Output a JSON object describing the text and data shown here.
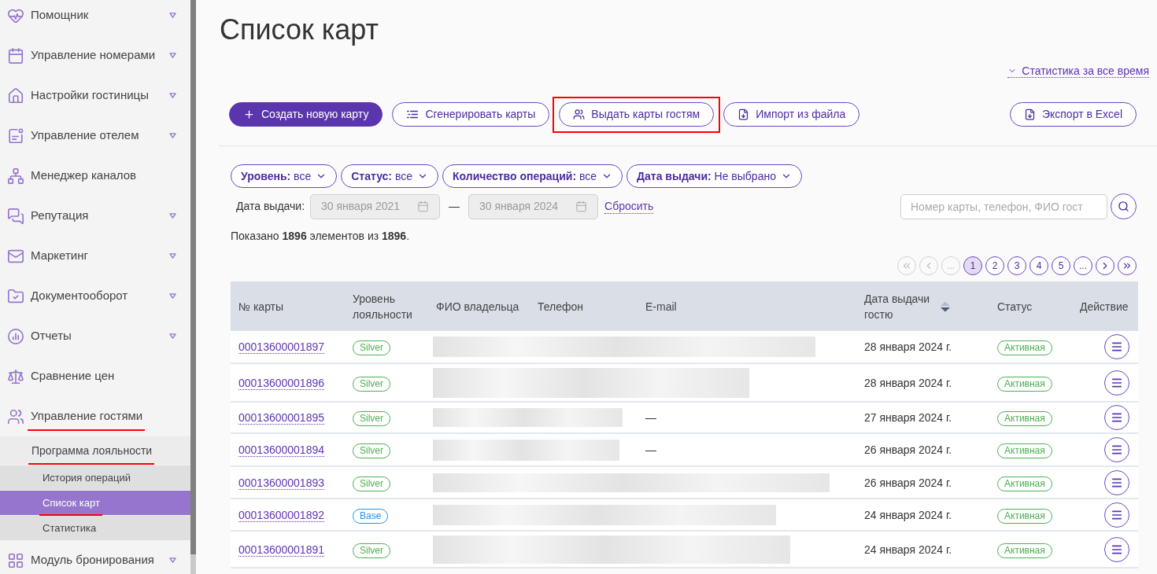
{
  "sidebar": {
    "items": [
      {
        "label": "Помощник",
        "expandable": true,
        "selected": false,
        "annotated": false
      },
      {
        "label": "Управление номерами",
        "expandable": true,
        "selected": false,
        "annotated": false
      },
      {
        "label": "Настройки гостиницы",
        "expandable": true,
        "selected": false,
        "annotated": false
      },
      {
        "label": "Управление отелем",
        "expandable": true,
        "selected": false,
        "annotated": false
      },
      {
        "label": "Менеджер каналов",
        "expandable": false,
        "selected": false,
        "annotated": false
      },
      {
        "label": "Репутация",
        "expandable": true,
        "selected": false,
        "annotated": false
      },
      {
        "label": "Маркетинг",
        "expandable": true,
        "selected": false,
        "annotated": false
      },
      {
        "label": "Документооборот",
        "expandable": true,
        "selected": false,
        "annotated": false
      },
      {
        "label": "Отчеты",
        "expandable": true,
        "selected": false,
        "annotated": false
      },
      {
        "label": "Сравнение цен",
        "expandable": false,
        "selected": false,
        "annotated": false
      },
      {
        "label": "Управление гостями",
        "expandable": false,
        "selected": false,
        "annotated": true,
        "children": [
          {
            "label": "Программа лояльности",
            "selected": false,
            "annotated": true,
            "children": [
              {
                "label": "История операций",
                "selected": false,
                "annotated": false
              },
              {
                "label": "Список карт",
                "selected": true,
                "annotated": true
              },
              {
                "label": "Статистика",
                "selected": false,
                "annotated": false
              }
            ]
          }
        ]
      },
      {
        "label": "Модуль бронирования",
        "expandable": true,
        "selected": false,
        "annotated": false
      }
    ]
  },
  "page": {
    "title": "Список карт",
    "stats_link": "Статистика за все время"
  },
  "toolbar": {
    "actions": [
      {
        "label": "Создать новую карту",
        "kind": "primary",
        "annotated": false
      },
      {
        "label": "Сгенерировать карты",
        "kind": "outline",
        "annotated": false
      },
      {
        "label": "Выдать карты гостям",
        "kind": "outline",
        "annotated": true
      },
      {
        "label": "Импорт из файла",
        "kind": "outline",
        "annotated": false
      }
    ],
    "export": {
      "label": "Экспорт в Excel",
      "kind": "outline"
    }
  },
  "filters": [
    {
      "label": "Уровень:",
      "value": "все"
    },
    {
      "label": "Статус:",
      "value": "все"
    },
    {
      "label": "Количество операций:",
      "value": "все"
    },
    {
      "label": "Дата выдачи:",
      "value": "Не выбрано"
    }
  ],
  "date_filter": {
    "label": "Дата выдачи:",
    "from": {
      "value": "30 января 2021",
      "disabled": true
    },
    "separator": "—",
    "to": {
      "value": "30 января 2024",
      "disabled": true
    },
    "reset": "Сбросить"
  },
  "search": {
    "placeholder": "Номер карты, телефон, ФИО гост"
  },
  "summary": "Показано **1896** элементов из **1896**.",
  "pagination": [
    {
      "kind": "first",
      "disabled": true,
      "selected": false
    },
    {
      "kind": "prev",
      "disabled": true,
      "selected": false
    },
    {
      "kind": "ellipsis",
      "label": "...",
      "disabled": true,
      "selected": false
    },
    {
      "kind": "page",
      "label": "1",
      "disabled": false,
      "selected": true
    },
    {
      "kind": "page",
      "label": "2",
      "disabled": false,
      "selected": false
    },
    {
      "kind": "page",
      "label": "3",
      "disabled": false,
      "selected": false
    },
    {
      "kind": "page",
      "label": "4",
      "disabled": false,
      "selected": false
    },
    {
      "kind": "page",
      "label": "5",
      "disabled": false,
      "selected": false
    },
    {
      "kind": "ellipsis",
      "label": "...",
      "disabled": false,
      "selected": false
    },
    {
      "kind": "next",
      "disabled": false,
      "selected": false
    },
    {
      "kind": "last",
      "disabled": false,
      "selected": false
    }
  ],
  "table": {
    "columns": [
      {
        "label": "№ карты",
        "sorted_descending": false
      },
      {
        "label": "Уровень лояльности",
        "sorted_descending": false
      },
      {
        "label": "ФИО владельца",
        "sorted_descending": false
      },
      {
        "label": "Телефон",
        "sorted_descending": false
      },
      {
        "label": "E-mail",
        "sorted_descending": false
      },
      {
        "label": "Дата выдачи гостю",
        "sorted_descending": true
      },
      {
        "label": "Статус",
        "sorted_descending": false
      },
      {
        "label": "Действие",
        "sorted_descending": false
      }
    ],
    "rows": [
      {
        "card": "00013600001897",
        "level": {
          "label": "Silver",
          "color": "#4caf50"
        },
        "redacted": true,
        "issued": "28 января 2024 г.",
        "status": {
          "label": "Активная",
          "color": "#4caf50"
        }
      },
      {
        "card": "00013600001896",
        "level": {
          "label": "Silver",
          "color": "#4caf50"
        },
        "redacted": true,
        "issued": "28 января 2024 г.",
        "status": {
          "label": "Активная",
          "color": "#4caf50"
        }
      },
      {
        "card": "00013600001895",
        "level": {
          "label": "Silver",
          "color": "#4caf50"
        },
        "redacted": true,
        "email": "—",
        "issued": "27 января 2024 г.",
        "status": {
          "label": "Активная",
          "color": "#4caf50"
        }
      },
      {
        "card": "00013600001894",
        "level": {
          "label": "Silver",
          "color": "#4caf50"
        },
        "redacted": true,
        "email": "—",
        "issued": "26 января 2024 г.",
        "status": {
          "label": "Активная",
          "color": "#4caf50"
        }
      },
      {
        "card": "00013600001893",
        "level": {
          "label": "Silver",
          "color": "#4caf50"
        },
        "redacted": true,
        "issued": "26 января 2024 г.",
        "status": {
          "label": "Активная",
          "color": "#4caf50"
        }
      },
      {
        "card": "00013600001892",
        "level": {
          "label": "Base",
          "color": "#2196f3"
        },
        "redacted": true,
        "issued": "24 января 2024 г.",
        "status": {
          "label": "Активная",
          "color": "#4caf50"
        }
      },
      {
        "card": "00013600001891",
        "level": {
          "label": "Silver",
          "color": "#4caf50"
        },
        "redacted": true,
        "issued": "24 января 2024 г.",
        "status": {
          "label": "Активная",
          "color": "#4caf50"
        }
      }
    ]
  }
}
